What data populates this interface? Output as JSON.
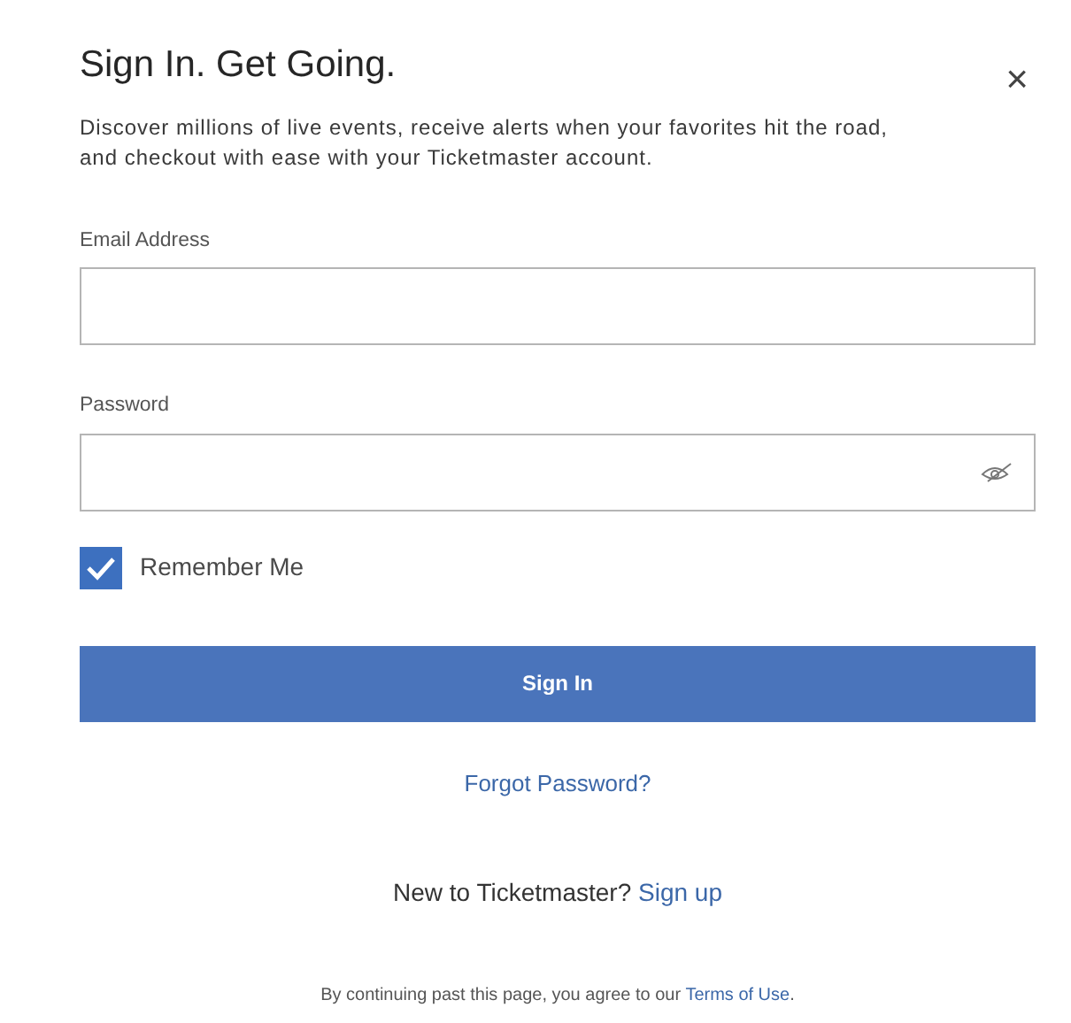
{
  "dialog": {
    "title": "Sign In. Get Going.",
    "close": "×",
    "description": "Discover millions of live events, receive alerts when your favorites hit the road, and checkout with ease with your Ticketmaster account."
  },
  "fields": [
    {
      "label": "Email Address",
      "kind": "text"
    },
    {
      "label": "Password",
      "kind": "password"
    }
  ],
  "remember_me": {
    "label": "Remember Me",
    "checked": true
  },
  "sign_in_button": "Sign In",
  "forgot_password": "Forgot Password?",
  "signup": {
    "prompt": "New to Ticketmaster?",
    "link": "Sign up"
  },
  "terms": {
    "prompt": "By continuing past this page, you agree to our",
    "link": "Terms of Use",
    "end": "."
  }
}
